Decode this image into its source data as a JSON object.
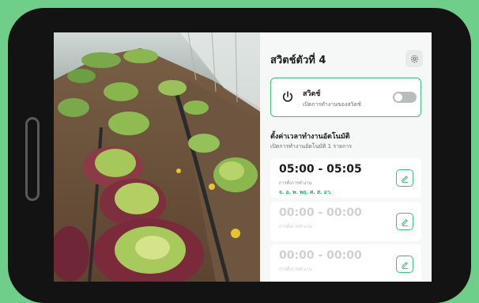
{
  "panel": {
    "title": "สวิตช์ตัวที่ 4",
    "settings_icon": "settings-gear-icon"
  },
  "switch": {
    "name": "สวิตช์",
    "description": "เปิดการทำงานของสวิตช์",
    "state": "off",
    "icon": "power-icon"
  },
  "schedule": {
    "title": "ตั้งค่าเวลาทำงานอัตโนมัติ",
    "subtitle": "เปิดการทำงานอัตโนมัติ 1 รายการ",
    "items": [
      {
        "time": "05:00 - 05:05",
        "label": "การตั้งการทำงาน",
        "days": "จ. อ. พ. พฤ. ศ. ส. อา.",
        "active": true
      },
      {
        "time": "00:00 - 00:00",
        "label": "การตั้งการทำงาน",
        "days": "",
        "active": false
      },
      {
        "time": "00:00 - 00:00",
        "label": "การตั้งการทำงาน",
        "days": "",
        "active": false
      }
    ]
  },
  "colors": {
    "accent": "#3cc07a",
    "days_text": "#2aa866",
    "background": "#6fcf8a",
    "device": "#131313"
  }
}
